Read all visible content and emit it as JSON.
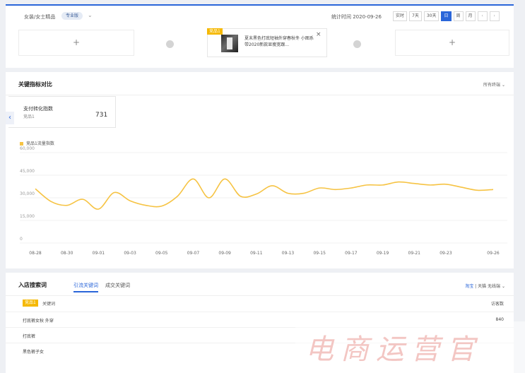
{
  "header": {
    "breadcrumb": "女装/女士精品",
    "edition_tag": "专业版",
    "stat_time": "统计时间 2020-09-26",
    "time_buttons": [
      "实时",
      "7天",
      "30天",
      "日",
      "周",
      "月"
    ],
    "active_time_button": "日"
  },
  "compare_strip": {
    "goods_card": {
      "badge": "竞品1",
      "title": "夏末黑色打底短袖外穿春秋冬 小图系带2020新款显瘦宽跟..."
    }
  },
  "key_metrics": {
    "section_title": "关键指标对比",
    "right_control": "所有终端",
    "metric_card": {
      "name": "支付转化指数",
      "sub": "竞品1",
      "value": "731"
    }
  },
  "chart_data": {
    "type": "line",
    "series": [
      {
        "name": "竞品1流量指数",
        "color": "#f6c343",
        "x": [
          "08-28",
          "08-29",
          "08-30",
          "08-31",
          "09-01",
          "09-02",
          "09-03",
          "09-04",
          "09-05",
          "09-06",
          "09-07",
          "09-08",
          "09-09",
          "09-10",
          "09-11",
          "09-12",
          "09-13",
          "09-14",
          "09-15",
          "09-16",
          "09-17",
          "09-18",
          "09-19",
          "09-20",
          "09-21",
          "09-22",
          "09-23",
          "09-24",
          "09-25",
          "09-26"
        ],
        "values": [
          36000,
          27500,
          25000,
          29000,
          22500,
          33500,
          28000,
          25000,
          24500,
          31000,
          42500,
          30000,
          42500,
          31000,
          32500,
          38000,
          33000,
          33000,
          36500,
          35500,
          36500,
          38500,
          38500,
          40500,
          39500,
          38500,
          39000,
          37000,
          35000,
          35500
        ]
      }
    ],
    "x_tick_labels": [
      "08-28",
      "08-30",
      "09-01",
      "09-03",
      "09-05",
      "09-07",
      "09-09",
      "09-11",
      "09-13",
      "09-15",
      "09-17",
      "09-19",
      "09-21",
      "09-23",
      "09-26"
    ],
    "y_ticks": [
      0,
      15000,
      30000,
      45000,
      60000
    ],
    "y_tick_labels": [
      "0",
      "15,000",
      "30,000",
      "45,000",
      "60,000"
    ],
    "ylim": [
      0,
      60000
    ],
    "grid": true,
    "legend_position": "top-left"
  },
  "search_keywords": {
    "section_title": "入店搜索词",
    "tabs": [
      "引流关键词",
      "成交关键词"
    ],
    "active_tab": "引流关键词",
    "right_links": {
      "a": "淘宝",
      "sep": "|",
      "b": "天猫",
      "c": "无线端"
    },
    "table": {
      "badge": "竞品1",
      "col_keyword": "关键词",
      "col_visitors": "访客数",
      "rows": [
        {
          "keyword": "打底裤女秋 外穿",
          "visitors": "840"
        },
        {
          "keyword": "打底裤",
          "visitors": ""
        },
        {
          "keyword": "黑色裤子女",
          "visitors": ""
        }
      ]
    }
  },
  "watermark": "电商运营官"
}
